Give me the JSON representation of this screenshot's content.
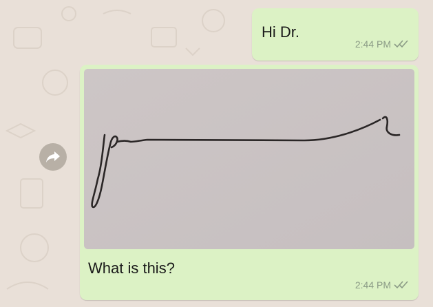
{
  "colors": {
    "wallpaper": "#e9e0d8",
    "outgoing_bubble": "#dcf2c5",
    "photo_paper": "#cfc8c8",
    "ink": "#2a2626"
  },
  "messages": [
    {
      "text": "Hi Dr.",
      "time": "2:44 PM",
      "status_icon": "double-check-icon"
    },
    {
      "text": "What is this?",
      "time": "2:44 PM",
      "status_icon": "double-check-icon",
      "attachment": "photo-of-handwritten-scribble"
    }
  ],
  "forward_icon": "forward-arrow-icon"
}
